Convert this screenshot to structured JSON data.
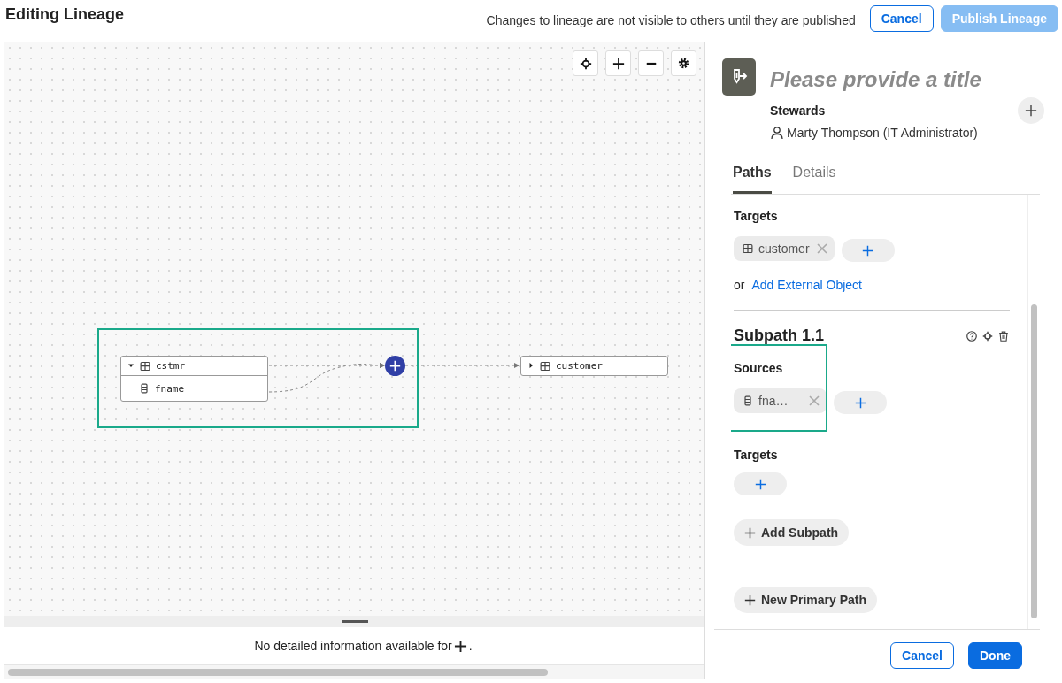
{
  "header": {
    "title": "Editing Lineage",
    "notice": "Changes to lineage are not visible to others until they are published",
    "buttons": [
      {
        "label": "Cancel",
        "kind": "secondary",
        "disabled": false
      },
      {
        "label": "Publish Lineage",
        "kind": "primary",
        "disabled": true
      }
    ]
  },
  "canvas": {
    "toolbar": [
      {
        "kind": "locate"
      },
      {
        "kind": "zoom-in"
      },
      {
        "kind": "zoom-out"
      },
      {
        "kind": "settings"
      }
    ],
    "group": {
      "highlighted": true
    },
    "nodes": [
      {
        "label": "cstmr",
        "kind": "table",
        "expanded": true,
        "children": [
          {
            "label": "fname",
            "kind": "column"
          }
        ]
      },
      {
        "label": "customer",
        "kind": "table",
        "expanded": false
      }
    ]
  },
  "details": {
    "message_start": "No detailed information available for",
    "message_end": "."
  },
  "panel": {
    "title_placeholder": "Please provide a title",
    "stewards_label": "Stewards",
    "stewards": [
      "Marty Thompson (IT Administrator)"
    ],
    "tabs": [
      {
        "label": "Paths",
        "selected": true
      },
      {
        "label": "Details",
        "selected": false
      }
    ],
    "targets_label": "Targets",
    "targets": [
      {
        "label": "customer",
        "kind": "table"
      }
    ],
    "or_text": "or",
    "external_link": "Add External Object",
    "subpaths": [
      {
        "title": "Subpath 1.1",
        "sources_label": "Sources",
        "sources_highlighted": true,
        "sources": [
          {
            "label": "fna…",
            "kind": "column"
          }
        ],
        "targets_label": "Targets"
      }
    ],
    "add_subpath": "Add Subpath",
    "new_primary_path": "New Primary Path",
    "footer_buttons": [
      {
        "label": "Cancel",
        "kind": "secondary"
      },
      {
        "label": "Done",
        "kind": "primary"
      }
    ]
  }
}
